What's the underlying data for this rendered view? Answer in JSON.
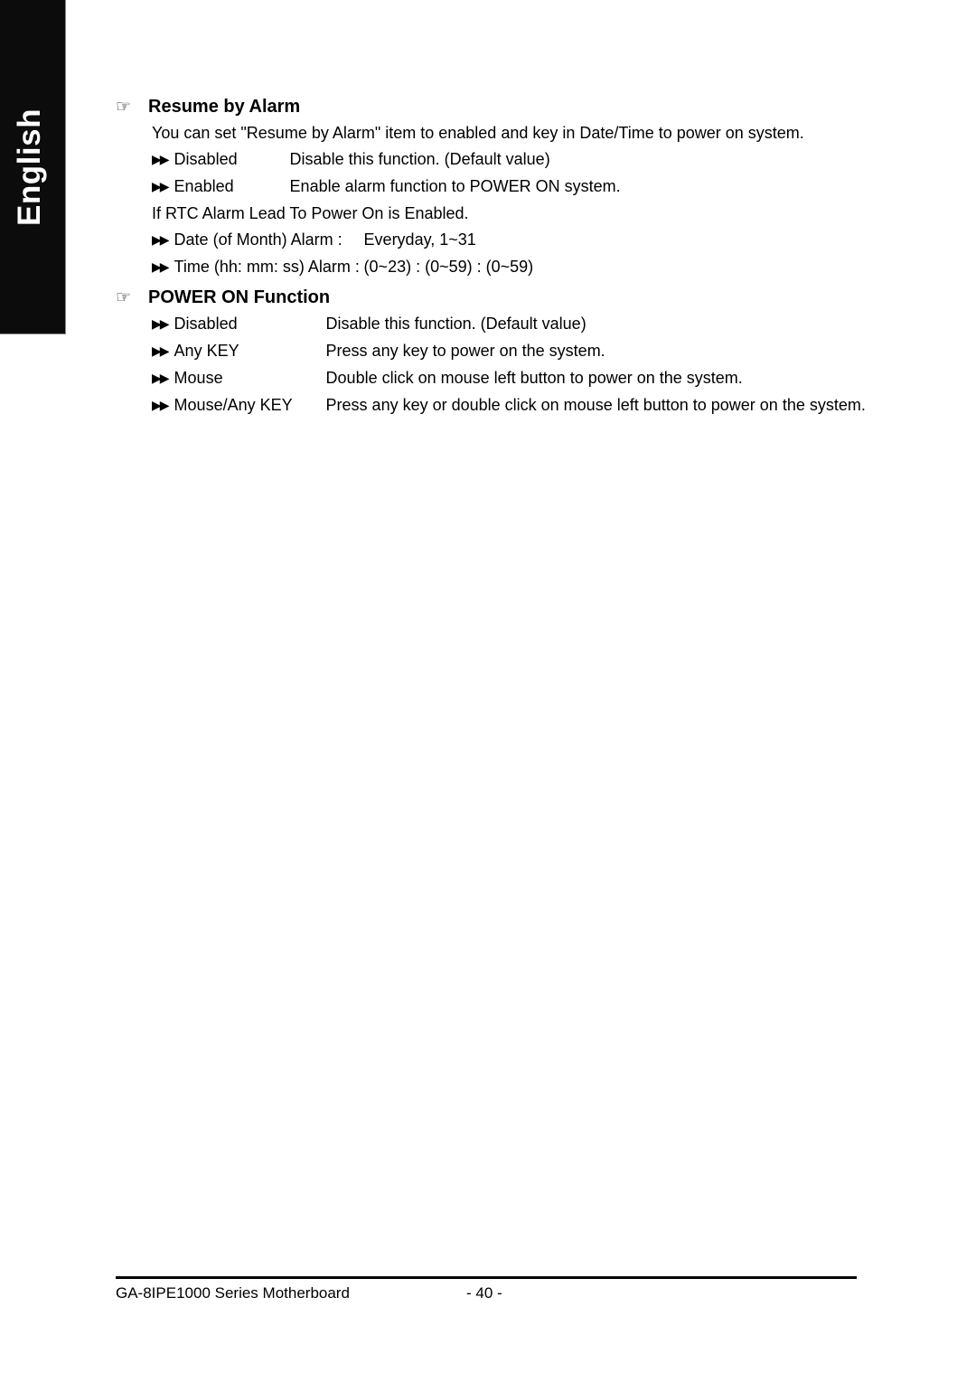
{
  "sidebar": {
    "language_label": "English"
  },
  "icons": {
    "hand_pointer": "☞",
    "double_arrow": "▶▶"
  },
  "sections": [
    {
      "heading": "Resume by Alarm",
      "intro": "You can set \"Resume by Alarm\" item to enabled and key in Date/Time to power on system.",
      "options": [
        {
          "name": "Disabled",
          "desc": "Disable this function. (Default value)"
        },
        {
          "name": "Enabled",
          "desc": "Enable alarm function to POWER ON system."
        }
      ],
      "note": "If RTC Alarm Lead To Power On is Enabled.",
      "datetime_options": [
        {
          "name": "Date (of Month) Alarm :",
          "desc": "Everyday, 1~31"
        },
        {
          "name": "Time (hh: mm: ss) Alarm :",
          "desc": "(0~23) : (0~59) : (0~59)"
        }
      ]
    },
    {
      "heading": "POWER ON Function",
      "options": [
        {
          "name": "Disabled",
          "desc": "Disable this function. (Default value)"
        },
        {
          "name": "Any KEY",
          "desc": "Press any key to power on the system."
        },
        {
          "name": "Mouse",
          "desc": "Double click on mouse left button to power on the system."
        },
        {
          "name": "Mouse/Any KEY",
          "desc": "Press any key or double click on mouse left button to power on the system."
        }
      ]
    }
  ],
  "footer": {
    "left_text": "GA-8IPE1000 Series Motherboard",
    "page_number": "- 40 -"
  }
}
